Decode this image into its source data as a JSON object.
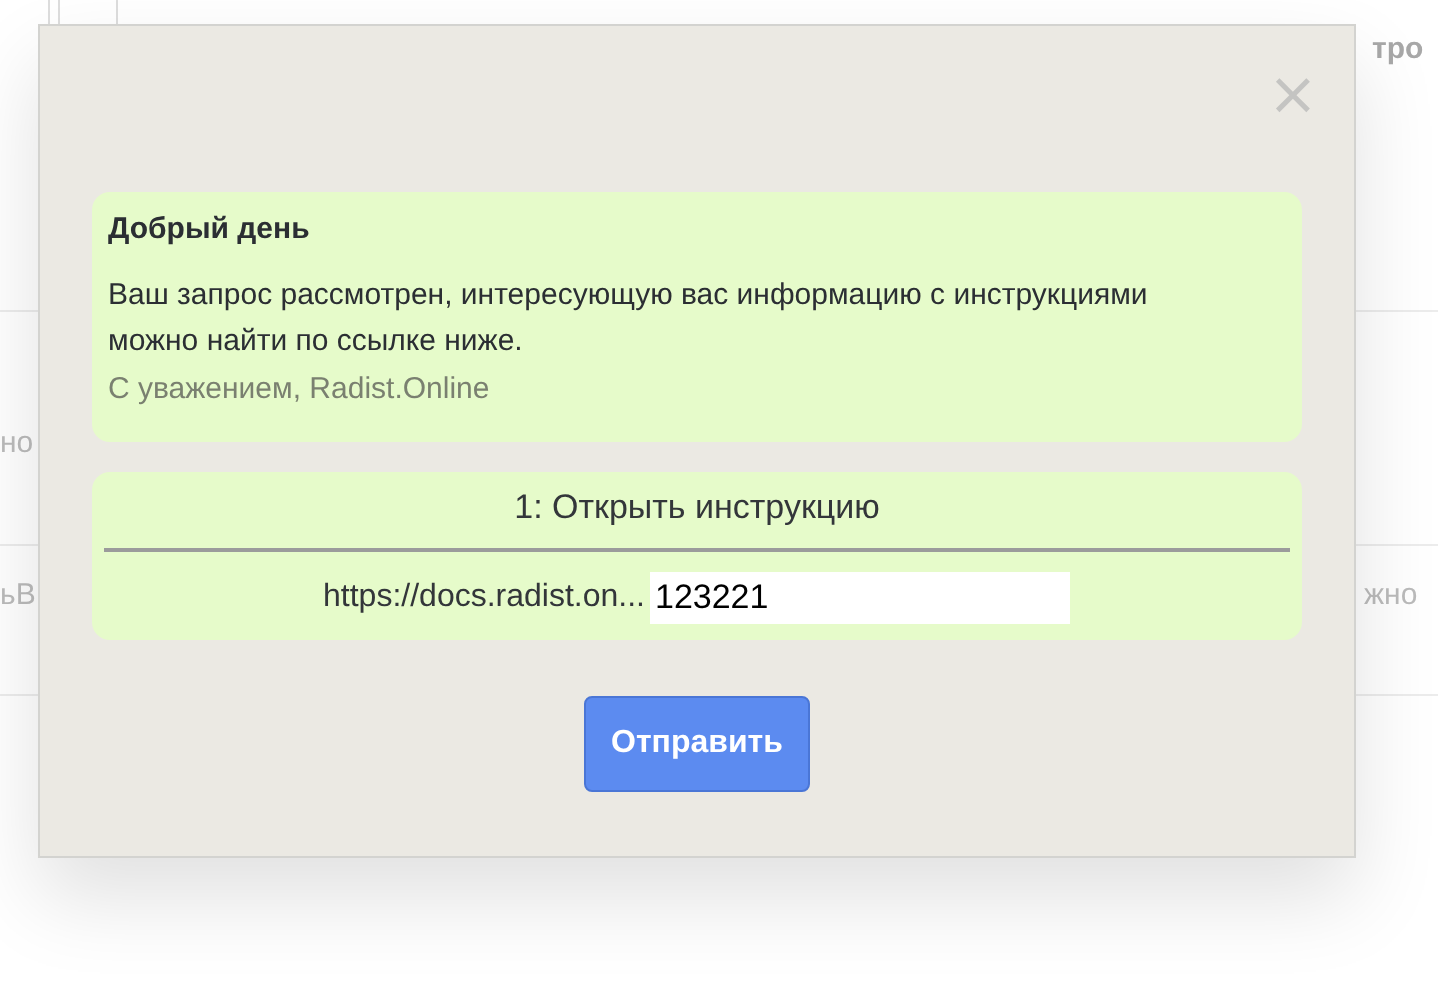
{
  "background": {
    "top_right": "тро",
    "mid_left": "но",
    "low_left": "ьВ",
    "low_right": "жно"
  },
  "dialog": {
    "close": "×",
    "message": {
      "title": "Добрый день",
      "body": "Ваш запрос рассмотрен, интересующую вас информацию с инструкциями можно найти по ссылке ниже.",
      "signature": "С уважением, Radist.Online"
    },
    "links": [
      {
        "title": "1: Открыть инструкцию",
        "url": "https://docs.radist.on...",
        "value": "123221"
      }
    ],
    "button": "Отправить"
  }
}
